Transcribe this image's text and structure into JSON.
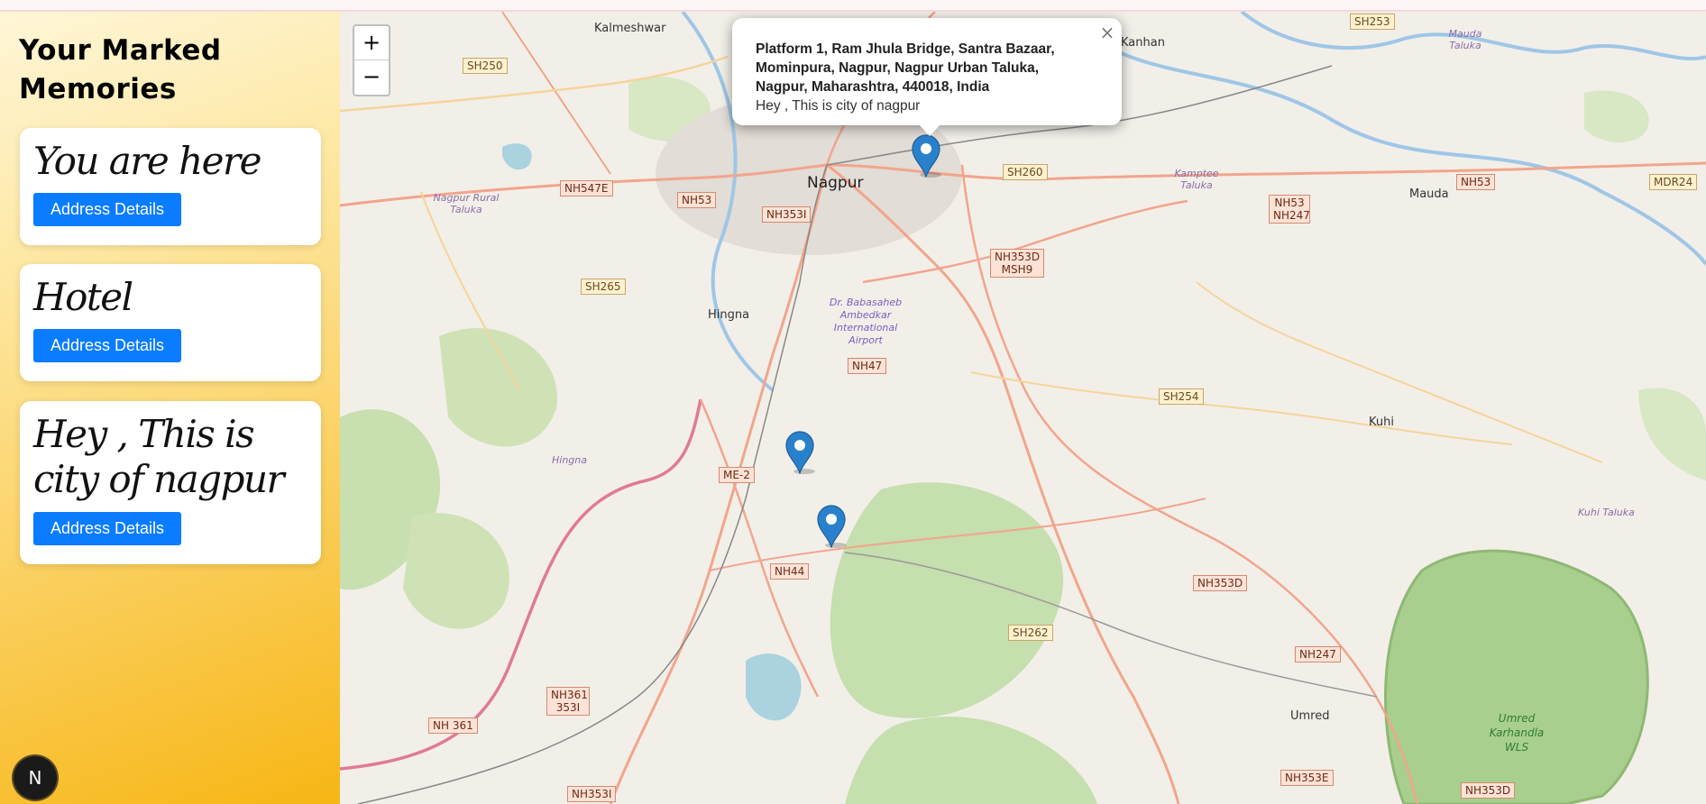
{
  "sidebar": {
    "title": "Your Marked Memories",
    "cards": [
      {
        "title": "You are here",
        "button": "Address Details"
      },
      {
        "title": "Hotel",
        "button": "Address Details"
      },
      {
        "title": "Hey , This is city of nagpur",
        "button": "Address Details"
      }
    ],
    "badge_letter": "N"
  },
  "map": {
    "zoom_in": "+",
    "zoom_out": "−",
    "popup": {
      "close": "×",
      "address": "Platform 1, Ram Jhula Bridge, Santra Bazaar, Mominpura, Nagpur, Nagpur Urban Taluka, Nagpur, Maharashtra, 440018, India",
      "note": "Hey , This is city of nagpur"
    },
    "places": {
      "nagpur": "Nagpur",
      "kalmeshwar": "Kalmeshwar",
      "kanhan": "Kanhan",
      "mauda": "Mauda",
      "hingna": "Hingna",
      "kuhi": "Kuhi",
      "umred": "Umred",
      "nagpur_rural": "Nagpur Rural Taluka",
      "kamptee": "Kamptee Taluka",
      "mauda_taluka": "Mauda Taluka",
      "airport": "Dr. Babasaheb Ambedkar International Airport",
      "hingna_area": "Hingna",
      "kuhi_taluka": "Kuhi Taluka",
      "umred_wls": "Umred Karhandla WLS"
    },
    "roads": {
      "sh250": "SH250",
      "sh253": "SH253",
      "nh547e": "NH547E",
      "nh53a": "NH53",
      "nh353i": "NH353I",
      "sh260": "SH260",
      "nh53b": "NH53",
      "nh53nh247": "NH53 NH247",
      "nh53c": "NH53",
      "mdr24": "MDR24",
      "sh265": "SH265",
      "nh353d_msh9": "NH353D MSH9",
      "nh47": "NH47",
      "sh254": "SH254",
      "me2": "ME-2",
      "nh44": "NH44",
      "nh353d": "NH353D",
      "sh262": "SH262",
      "nh247": "NH247",
      "nh361_353i": "NH361 353I",
      "nh361": "NH 361",
      "nh353e": "NH353E",
      "nh353i_b": "NH353I",
      "nh353d_b": "NH353D"
    }
  }
}
